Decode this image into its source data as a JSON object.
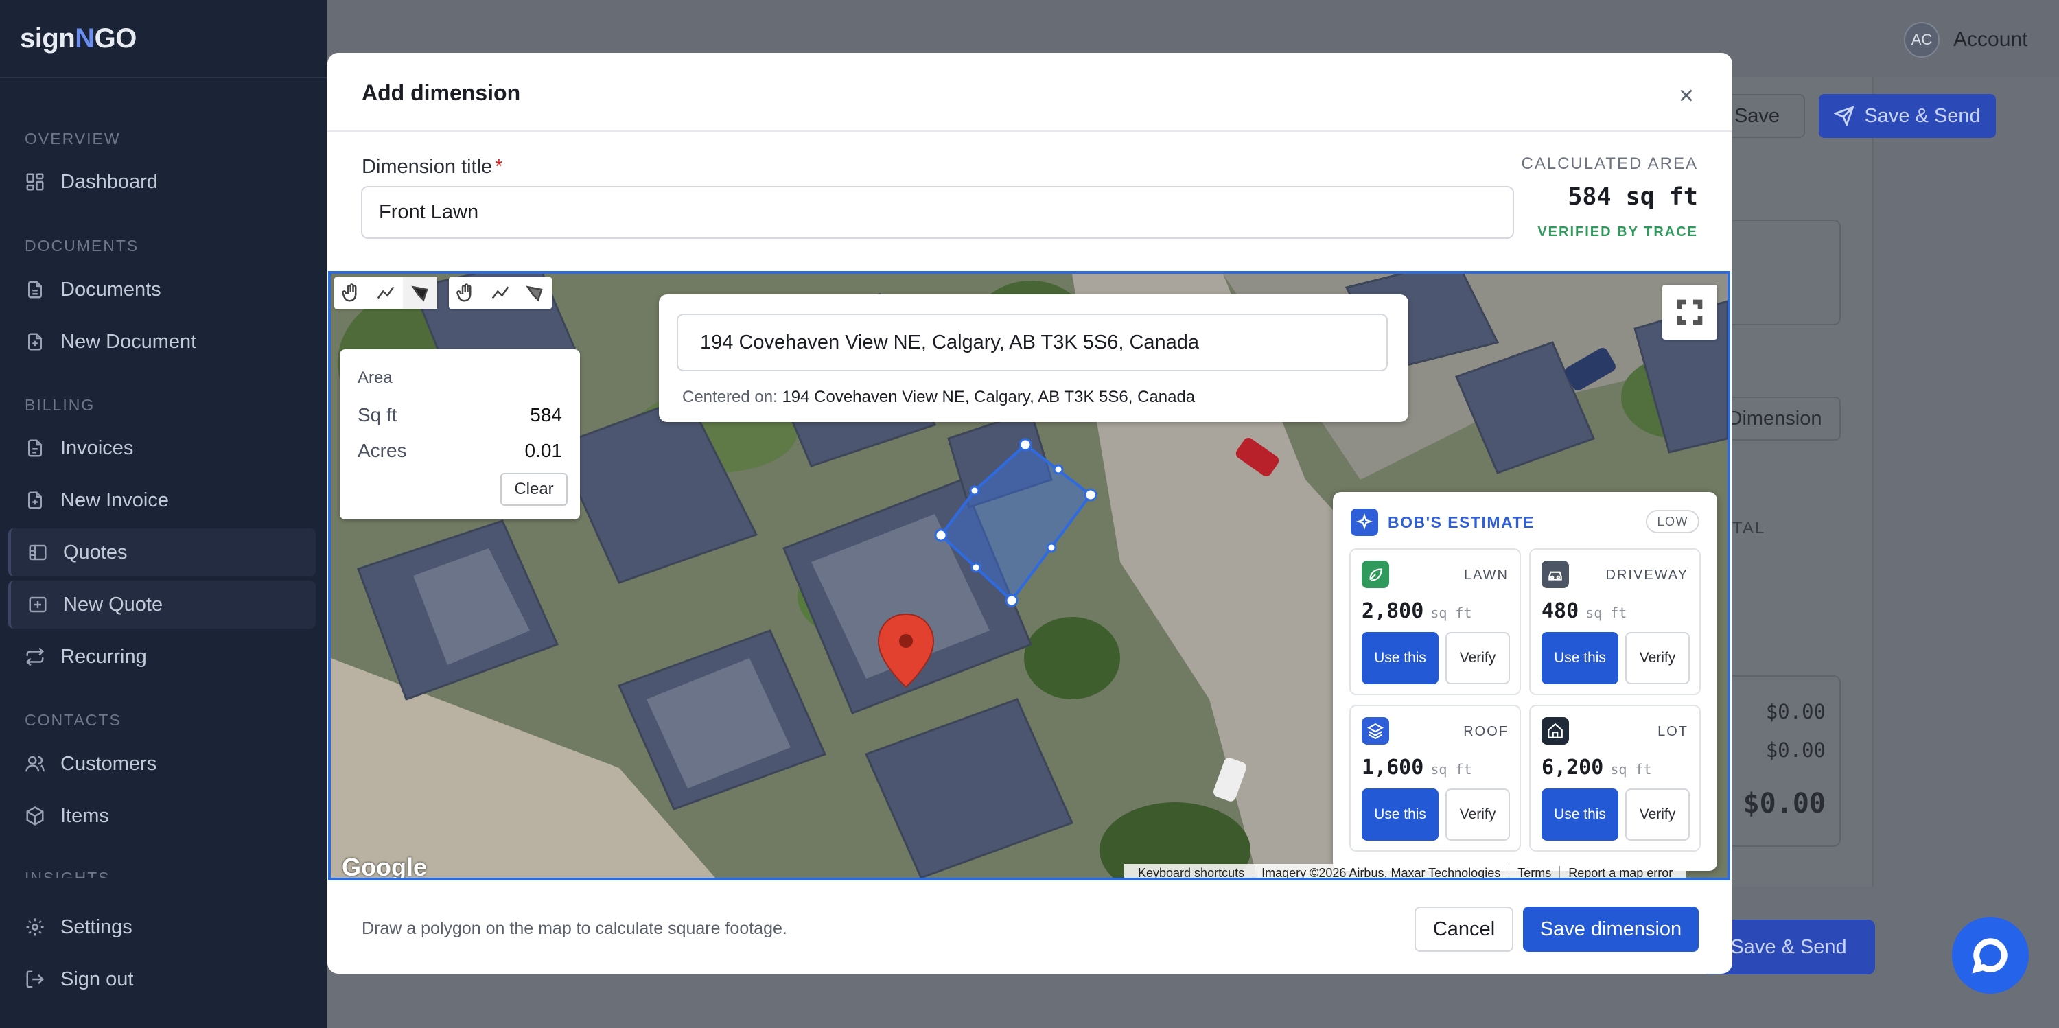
{
  "app": {
    "logo_pre": "sign",
    "logo_n": "N",
    "logo_post": "GO"
  },
  "sidebar": {
    "sections": [
      {
        "label": "OVERVIEW"
      },
      {
        "label": "DOCUMENTS"
      },
      {
        "label": "BILLING"
      },
      {
        "label": "CONTACTS"
      },
      {
        "label": "INSIGHTS"
      }
    ],
    "items": [
      {
        "label": "Dashboard",
        "icon": "dashboard-icon"
      },
      {
        "label": "Documents",
        "icon": "document-icon"
      },
      {
        "label": "New Document",
        "icon": "new-document-icon"
      },
      {
        "label": "Invoices",
        "icon": "invoice-icon"
      },
      {
        "label": "New Invoice",
        "icon": "new-invoice-icon"
      },
      {
        "label": "Quotes",
        "icon": "quotes-icon"
      },
      {
        "label": "New Quote",
        "icon": "new-quote-icon"
      },
      {
        "label": "Recurring",
        "icon": "recurring-icon"
      },
      {
        "label": "Customers",
        "icon": "customers-icon"
      },
      {
        "label": "Items",
        "icon": "items-icon"
      },
      {
        "label": "Settings",
        "icon": "gear-icon"
      },
      {
        "label": "Sign out",
        "icon": "sign-out-icon"
      }
    ]
  },
  "header": {
    "avatar_initials": "AC",
    "account_label": "Account",
    "save_label": "Save",
    "save_send_label": "Save & Send"
  },
  "background": {
    "dimension_button": "Dimension",
    "total_header": "TAL",
    "amounts": [
      "$0.00",
      "$0.00",
      "$0.00"
    ],
    "save_send_label": "Save & Send"
  },
  "modal": {
    "title": "Add dimension",
    "dimension_title_label": "Dimension title",
    "required_mark": "*",
    "dimension_title_value": "Front Lawn",
    "calculated_area_label": "CALCULATED AREA",
    "calculated_area_value": "584 sq ft",
    "verified_label": "VERIFIED BY TRACE",
    "helper_text": "Draw a polygon on the map to calculate square footage.",
    "cancel_label": "Cancel",
    "save_label": "Save dimension"
  },
  "map": {
    "address_value": "194 Covehaven View NE, Calgary, AB T3K 5S6, Canada",
    "centered_prefix": "Centered on:",
    "centered_address": "194 Covehaven View NE, Calgary, AB T3K 5S6, Canada",
    "area_panel": {
      "title": "Area",
      "sqft_label": "Sq ft",
      "sqft_value": "584",
      "acres_label": "Acres",
      "acres_value": "0.01",
      "clear_label": "Clear"
    },
    "google_label": "Google",
    "footer_links": [
      "Keyboard shortcuts",
      "Imagery ©2026 Airbus, Maxar Technologies",
      "Terms",
      "Report a map error"
    ],
    "polygon_color": "#2f6be0"
  },
  "estimate": {
    "title": "BOB'S ESTIMATE",
    "confidence": "LOW",
    "unit": "sq ft",
    "use_label": "Use this",
    "verify_label": "Verify",
    "cards": [
      {
        "name": "LAWN",
        "value": "2,800",
        "icon": "leaf-icon",
        "color": "#2f9a5b"
      },
      {
        "name": "DRIVEWAY",
        "value": "480",
        "icon": "car-icon",
        "color": "#4b5563"
      },
      {
        "name": "ROOF",
        "value": "1,600",
        "icon": "layers-icon",
        "color": "#2f5fd8"
      },
      {
        "name": "LOT",
        "value": "6,200",
        "icon": "home-icon",
        "color": "#1f2937"
      }
    ]
  },
  "colors": {
    "primary": "#2459d6",
    "sidebar_bg": "#1b2336",
    "verified_green": "#2f9a5b"
  }
}
